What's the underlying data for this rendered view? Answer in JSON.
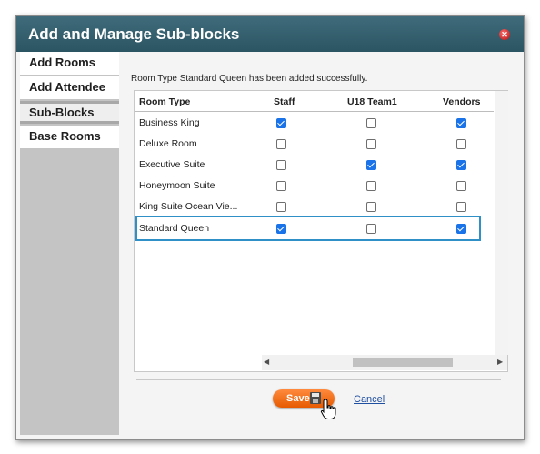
{
  "dialog": {
    "title": "Add and Manage Sub-blocks",
    "close_icon": "close-icon",
    "accent_color": "#2f8fc7",
    "titlebar_color": "#2c5563"
  },
  "sidebar": {
    "items": [
      {
        "label": "Add Rooms",
        "active": false
      },
      {
        "label": "Add Attendee",
        "active": false
      },
      {
        "label": "Sub-Blocks",
        "active": true
      },
      {
        "label": "Base Rooms",
        "active": false
      }
    ]
  },
  "main": {
    "message": "Room Type Standard Queen has been added successfully.",
    "columns": [
      "Room Type",
      "Staff",
      "U18 Team1",
      "Vendors"
    ],
    "rows": [
      {
        "room_type": "Business King",
        "checks": [
          true,
          false,
          true
        ]
      },
      {
        "room_type": "Deluxe Room",
        "checks": [
          false,
          false,
          false
        ]
      },
      {
        "room_type": "Executive Suite",
        "checks": [
          false,
          true,
          true
        ]
      },
      {
        "room_type": "Honeymoon Suite",
        "checks": [
          false,
          false,
          false
        ]
      },
      {
        "room_type": "King Suite Ocean Vie...",
        "checks": [
          false,
          false,
          false
        ]
      },
      {
        "room_type": "Standard Queen",
        "checks": [
          true,
          false,
          true
        ],
        "highlighted": true
      }
    ]
  },
  "footer": {
    "save_label": "Save",
    "save_icon": "floppy-disk-icon",
    "cancel_label": "Cancel",
    "save_color": "#f26c0d"
  }
}
